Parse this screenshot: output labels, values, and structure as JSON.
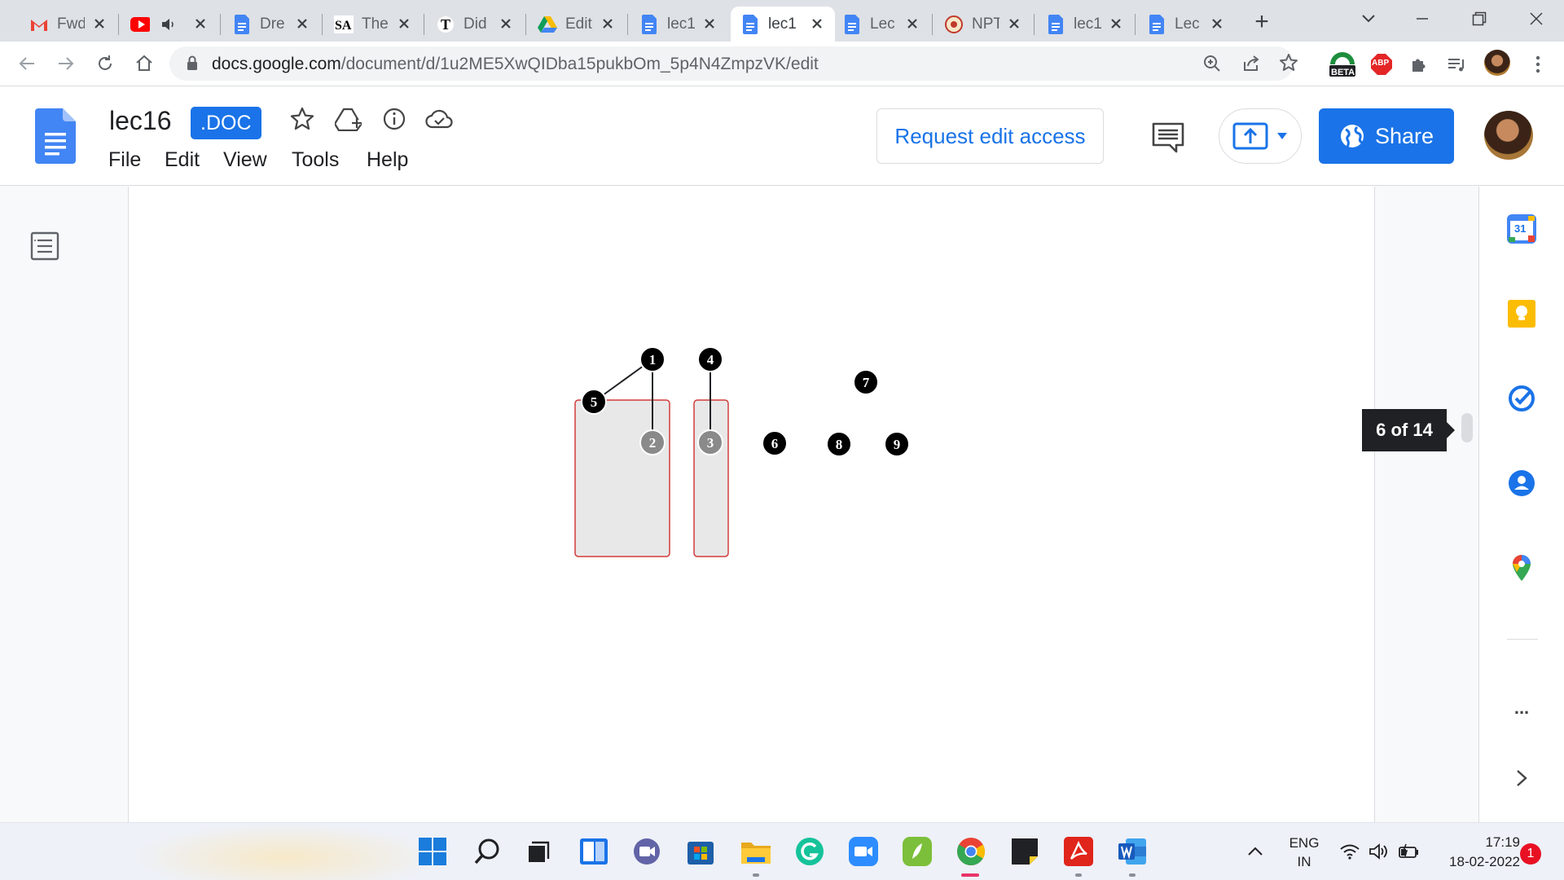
{
  "browser": {
    "tabs": [
      {
        "title": "Fwd",
        "icon": "gmail-icon"
      },
      {
        "title": "",
        "icon": "youtube-icon",
        "audio": true
      },
      {
        "title": "Dre",
        "icon": "docs-icon"
      },
      {
        "title": "The",
        "icon": "sa-icon"
      },
      {
        "title": "Did",
        "icon": "nyt-icon"
      },
      {
        "title": "Edit",
        "icon": "drive-icon"
      },
      {
        "title": "lec1",
        "icon": "docs-icon"
      },
      {
        "title": "lec1",
        "icon": "docs-icon",
        "active": true
      },
      {
        "title": "Lec",
        "icon": "docs-icon"
      },
      {
        "title": "NPT",
        "icon": "nptel-icon"
      },
      {
        "title": "lec1",
        "icon": "docs-icon"
      },
      {
        "title": "Lec",
        "icon": "docs-icon"
      }
    ],
    "new_tab_label": "+",
    "url_host": "docs.google.com",
    "url_path": "/document/d/1u2ME5XwQIDba15pukbOm_5p4N4ZmpzVK/edit",
    "beta_badge": "BETA",
    "abp_badge": "ABP"
  },
  "docs": {
    "title": "lec16",
    "badge": ".DOC",
    "menu": [
      "File",
      "Edit",
      "View",
      "Tools",
      "Help"
    ],
    "request_edit_label": "Request edit access",
    "share_label": "Share",
    "page_indicator": "6 of 14"
  },
  "graph": {
    "nodes": [
      "1",
      "2",
      "3",
      "4",
      "5",
      "6",
      "7",
      "8",
      "9"
    ],
    "edges": [
      [
        "1",
        "5"
      ],
      [
        "1",
        "2"
      ],
      [
        "4",
        "3"
      ]
    ],
    "highlighted_nodes": [
      "2",
      "3"
    ],
    "components": [
      [
        "1",
        "2",
        "5"
      ],
      [
        "3",
        "4"
      ]
    ]
  },
  "side_panel": {
    "calendar_day": "31",
    "more_label": "...",
    "expand_label": ">"
  },
  "taskbar": {
    "language": "ENG",
    "region": "IN",
    "time": "17:19",
    "date": "18-02-2022",
    "notifications": "1"
  },
  "colors": {
    "accent": "#1a73e8",
    "component_border": "#d33a3a",
    "component_fill": "#e8e8e8",
    "node_fill": "#000000",
    "highlight_node_fill": "#8a8a8a"
  }
}
